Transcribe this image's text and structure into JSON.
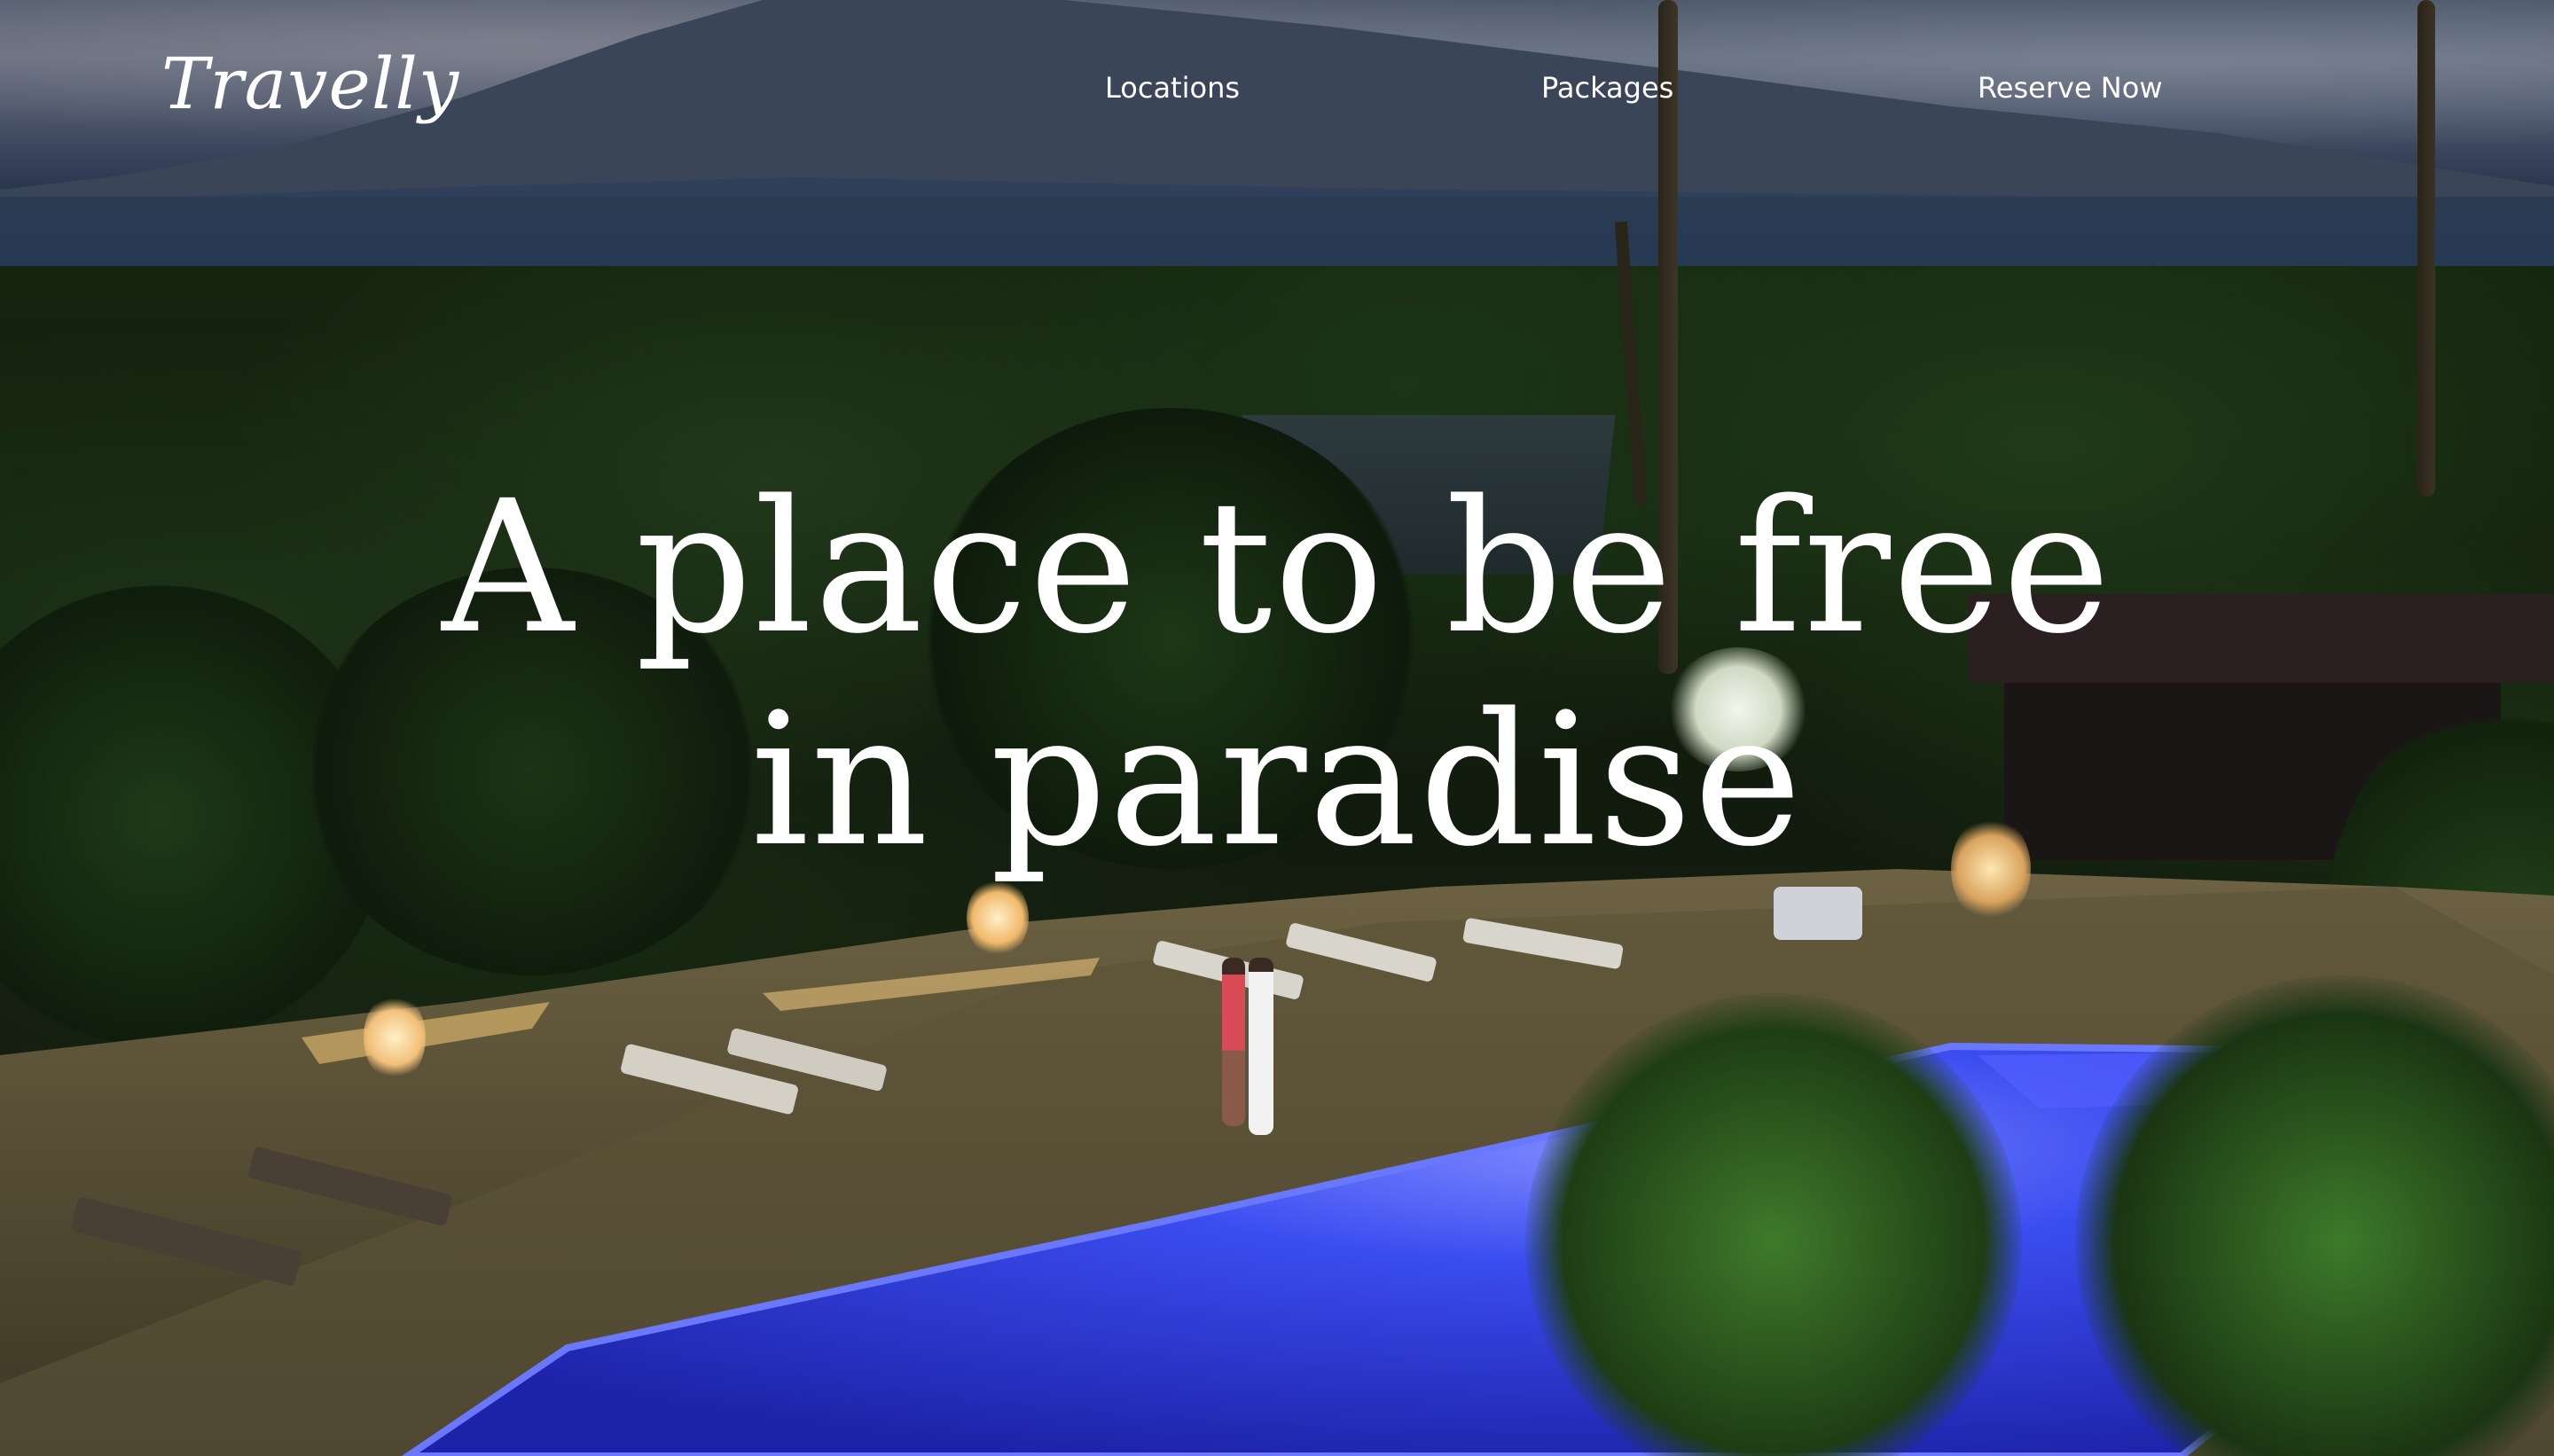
{
  "brand": {
    "logo": "Travelly"
  },
  "nav": {
    "links": [
      {
        "label": "Locations"
      },
      {
        "label": "Packages"
      },
      {
        "label": "Reserve Now"
      }
    ]
  },
  "hero": {
    "headline_line1": "A place to be free",
    "headline_line2": "in paradise",
    "background_description": null
  },
  "colors": {
    "text": "#ffffff",
    "pool": "#3b4df0",
    "foliage": "#1b3516",
    "sky": "#4a5668"
  }
}
